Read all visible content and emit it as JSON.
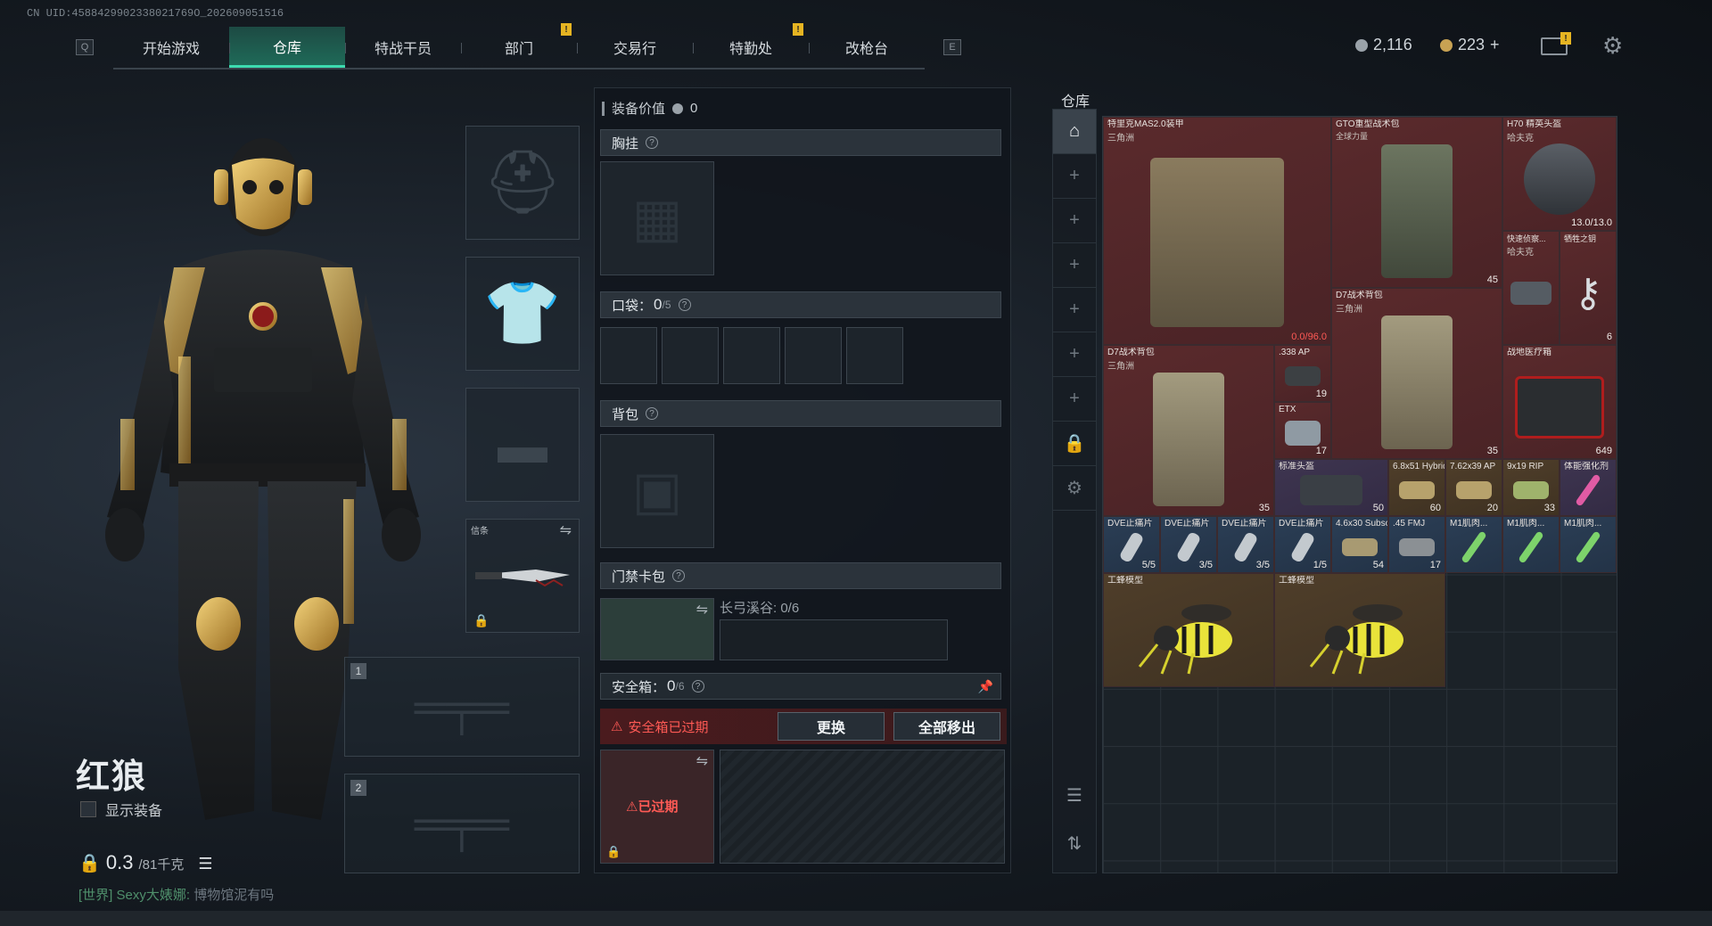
{
  "uid": "CN UID:4588429902338021769O_202609051516",
  "nav": {
    "left_key": "Q",
    "right_key": "E",
    "tabs": [
      "开始游戏",
      "仓库",
      "特战干员",
      "部门",
      "交易行",
      "特勤处",
      "改枪台"
    ],
    "badge": "!"
  },
  "currency": {
    "silver": "2,116",
    "gold": "223",
    "gold_plus": "+"
  },
  "character": {
    "name": "红狼",
    "show_equipment": "显示装备",
    "weight_value": "0.3",
    "weight_max": "/81千克",
    "melee_label": "信条",
    "weapon_slot_1": "1",
    "weapon_slot_2": "2"
  },
  "chat": {
    "channel": "[世界]",
    "user": "Sexy大婊娜:",
    "message": "博物馆泥有吗"
  },
  "equipment": {
    "value_label": "装备价值",
    "value": "0",
    "chest_rig": "胸挂",
    "pockets": "口袋：",
    "pockets_count": "0",
    "pockets_max": "/5",
    "backpack": "背包",
    "keycard": "门禁卡包",
    "keycard_content": "长弓溪谷: 0/6",
    "safebox": "安全箱：",
    "safebox_count": "0",
    "safebox_max": "/6",
    "expired_warning": "安全箱已过期",
    "expired_badge": "已过期",
    "replace_btn": "更换",
    "remove_all_btn": "全部移出",
    "help": "?"
  },
  "storage": {
    "title": "仓库",
    "items": [
      {
        "name": "特里克MAS2.0装甲",
        "sub": "三角洲",
        "count": "0.0/96.0",
        "rarity": "red",
        "kind": "armor"
      },
      {
        "name": "GTO重型战术包",
        "sub": "全球力量",
        "count": "45",
        "rarity": "red",
        "kind": "bag"
      },
      {
        "name": "H70 精英头盔",
        "sub": "哈夫克",
        "count": "13.0/13.0",
        "rarity": "red",
        "kind": "helmet"
      },
      {
        "name": "快速侦察...",
        "sub": "哈夫克",
        "count": "",
        "rarity": "red",
        "kind": "small"
      },
      {
        "name": "牺牲之钥",
        "sub": "",
        "count": "6",
        "rarity": "red",
        "kind": "key"
      },
      {
        "name": "D7战术背包",
        "sub": "三角洲",
        "count": "35",
        "rarity": "red",
        "kind": "bag"
      },
      {
        "name": "D7战术背包",
        "sub": "三角洲",
        "count": "35",
        "rarity": "red",
        "kind": "bag"
      },
      {
        "name": ".338 AP",
        "sub": "",
        "count": "19",
        "rarity": "red",
        "kind": "ammo"
      },
      {
        "name": "ETX",
        "sub": "",
        "count": "17",
        "rarity": "red",
        "kind": "ammo"
      },
      {
        "name": "战地医疗箱",
        "sub": "",
        "count": "649",
        "rarity": "red",
        "kind": "medkit"
      },
      {
        "name": "标准头盔",
        "sub": "",
        "count": "50",
        "rarity": "purple",
        "kind": "small"
      },
      {
        "name": "6.8x51 Hybrid",
        "sub": "",
        "count": "60",
        "rarity": "gold",
        "kind": "ammo"
      },
      {
        "name": "7.62x39 AP",
        "sub": "",
        "count": "20",
        "rarity": "gold",
        "kind": "ammo"
      },
      {
        "name": "9x19 RIP",
        "sub": "",
        "count": "33",
        "rarity": "gold",
        "kind": "ammo"
      },
      {
        "name": "体能强化剂",
        "sub": "",
        "count": "",
        "rarity": "purple",
        "kind": "syringe"
      },
      {
        "name": "DVE止痛片",
        "sub": "",
        "count": "5/5",
        "rarity": "blue",
        "kind": "pill"
      },
      {
        "name": "DVE止痛片",
        "sub": "",
        "count": "3/5",
        "rarity": "blue",
        "kind": "pill"
      },
      {
        "name": "DVE止痛片",
        "sub": "",
        "count": "3/5",
        "rarity": "blue",
        "kind": "pill"
      },
      {
        "name": "DVE止痛片",
        "sub": "",
        "count": "1/5",
        "rarity": "blue",
        "kind": "pill"
      },
      {
        "name": "4.6x30 Subsonic",
        "sub": "",
        "count": "54",
        "rarity": "blue",
        "kind": "ammo"
      },
      {
        "name": ".45 FMJ",
        "sub": "",
        "count": "17",
        "rarity": "blue",
        "kind": "ammo"
      },
      {
        "name": "M1肌肉...",
        "sub": "",
        "count": "",
        "rarity": "blue",
        "kind": "syringe"
      },
      {
        "name": "M1肌肉...",
        "sub": "",
        "count": "",
        "rarity": "blue",
        "kind": "syringe"
      },
      {
        "name": "M1肌肉...",
        "sub": "",
        "count": "",
        "rarity": "blue",
        "kind": "syringe"
      },
      {
        "name": "工蜂模型",
        "sub": "",
        "count": "",
        "rarity": "gold",
        "kind": "bee"
      },
      {
        "name": "工蜂模型",
        "sub": "",
        "count": "",
        "rarity": "gold",
        "kind": "bee"
      }
    ]
  },
  "colors": {
    "accent": "#3ddbb0",
    "danger": "#ff5a55",
    "badge": "#e6b422"
  }
}
